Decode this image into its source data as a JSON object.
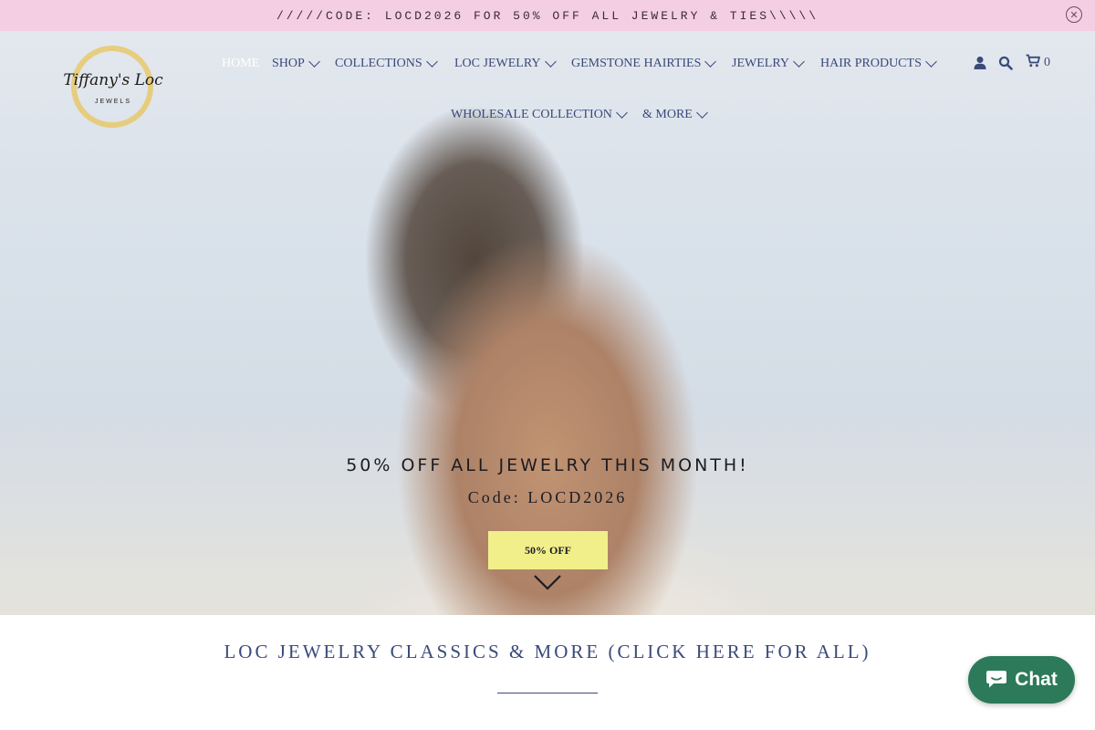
{
  "announcement": {
    "text": "/////CODE: LOCD2026 FOR 50% OFF ALL JEWELRY & TIES\\\\\\\\\\",
    "close_icon": "close-circle-icon"
  },
  "logo": {
    "name": "Tiffany's Loc",
    "sub": "JEWELS"
  },
  "nav": {
    "items": [
      {
        "label": "HOME",
        "dropdown": false
      },
      {
        "label": "SHOP",
        "dropdown": true
      },
      {
        "label": "COLLECTIONS",
        "dropdown": true
      },
      {
        "label": "LOC JEWELRY",
        "dropdown": true
      },
      {
        "label": "GEMSTONE HAIRTIES",
        "dropdown": true
      },
      {
        "label": "JEWELRY",
        "dropdown": true
      },
      {
        "label": "HAIR PRODUCTS",
        "dropdown": true
      },
      {
        "label": "WHOLESALE COLLECTION",
        "dropdown": true
      },
      {
        "label": "& MORE",
        "dropdown": true
      }
    ]
  },
  "header_icons": {
    "account": "user-icon",
    "search": "search-icon",
    "cart": "cart-icon",
    "cart_count": "0"
  },
  "hero": {
    "headline": "50% OFF ALL JEWELRY THIS MONTH!",
    "code": "Code: LOCD2026",
    "button_label": "50% OFF",
    "scroll_icon": "chevron-down-icon"
  },
  "section": {
    "title": "LOC JEWELRY CLASSICS & MORE (CLICK HERE FOR ALL)"
  },
  "chat": {
    "label": "Chat",
    "icon": "chat-bubble-icon",
    "color": "#2c7a5a"
  },
  "colors": {
    "announcement_bg": "#f4cfe4",
    "nav_text": "#3a4a7a",
    "button_bg": "#f1ef8a"
  }
}
